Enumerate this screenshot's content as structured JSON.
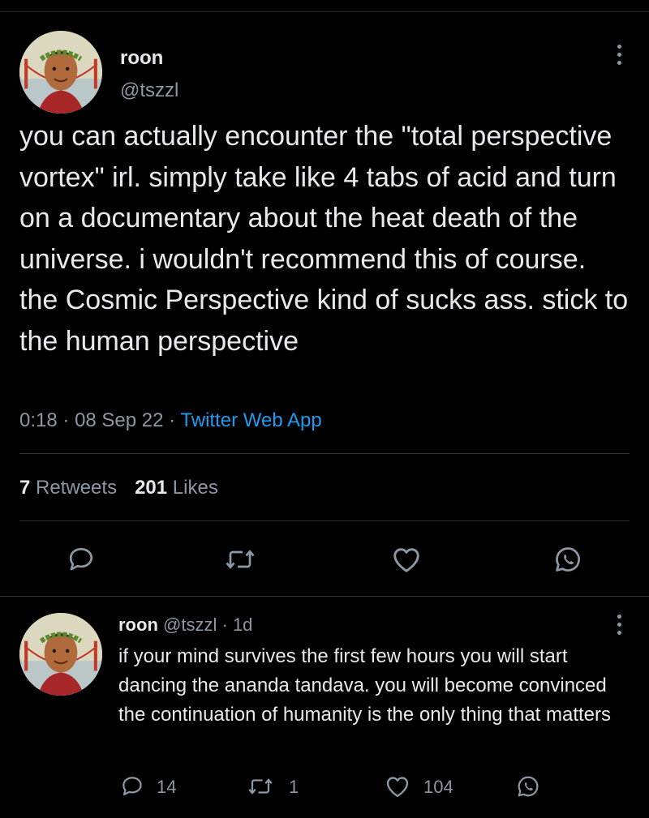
{
  "tweet": {
    "name": "roon",
    "handle": "@tszzl",
    "text": "you can actually encounter the \"total perspective vortex\" irl. simply take like 4 tabs of acid and turn on a documentary about the heat death of the universe. i wouldn't recommend this of course. the Cosmic Perspective kind of sucks ass. stick to the human perspective",
    "time": "0:18",
    "date": "08 Sep 22",
    "source": "Twitter Web App",
    "retweets_count": "7",
    "retweets_label": "Retweets",
    "likes_count": "201",
    "likes_label": "Likes"
  },
  "reply": {
    "name": "roon",
    "handle": "@tszzl",
    "age": "1d",
    "text": "if your mind survives the first few hours you will start dancing the ananda tandava. you will become convinced the continuation of humanity is the only thing that matters",
    "reply_count": "14",
    "retweet_count": "1",
    "like_count": "104"
  },
  "icons": {
    "reply": "reply-icon",
    "retweet": "retweet-icon",
    "like": "heart-icon",
    "share": "whatsapp-icon",
    "more": "more-vertical-icon"
  },
  "colors": {
    "background": "#000000",
    "text": "#e7e9ea",
    "secondary": "#8b98a5",
    "link": "#1d9bf0",
    "divider": "#2f3336"
  }
}
